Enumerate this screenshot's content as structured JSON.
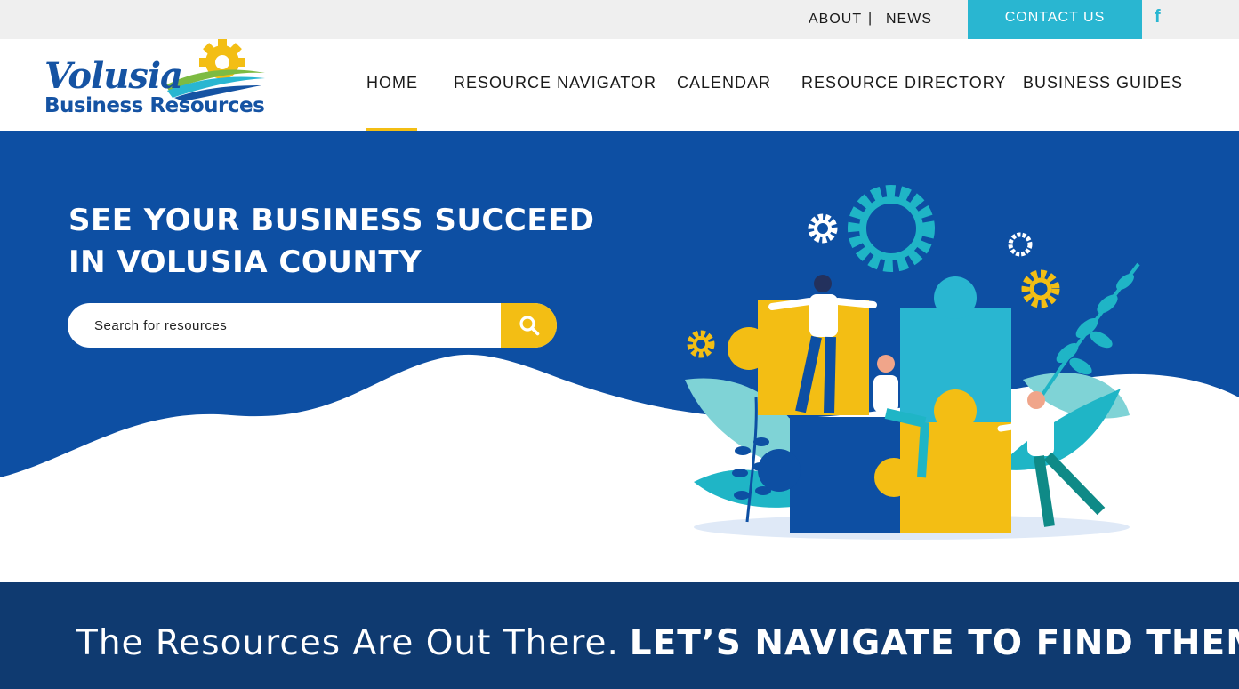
{
  "topbar": {
    "about": "ABOUT",
    "separator": "|",
    "news": "NEWS",
    "contact": "CONTACT US",
    "social_icon": "facebook-icon",
    "social_glyph": "f"
  },
  "logo": {
    "name": "Volusia",
    "subtitle": "Business Resources"
  },
  "nav": {
    "items": [
      {
        "label": "HOME",
        "active": true
      },
      {
        "label": "RESOURCE NAVIGATOR",
        "active": false
      },
      {
        "label": "CALENDAR",
        "active": false
      },
      {
        "label": "RESOURCE DIRECTORY",
        "active": false
      },
      {
        "label": "BUSINESS GUIDES",
        "active": false
      }
    ]
  },
  "hero": {
    "title_line1": "SEE YOUR BUSINESS SUCCEED",
    "title_line2": "IN VOLUSIA COUNTY",
    "search_placeholder": "Search for resources",
    "search_icon": "search-icon"
  },
  "band": {
    "lead": "The Resources Are Out There.",
    "emphasis": "LET’S NAVIGATE TO FIND THEM"
  },
  "colors": {
    "brand_blue": "#0d4fa3",
    "dark_navy": "#0f3a70",
    "accent_yellow": "#f3be14",
    "accent_teal": "#29b6d1"
  }
}
